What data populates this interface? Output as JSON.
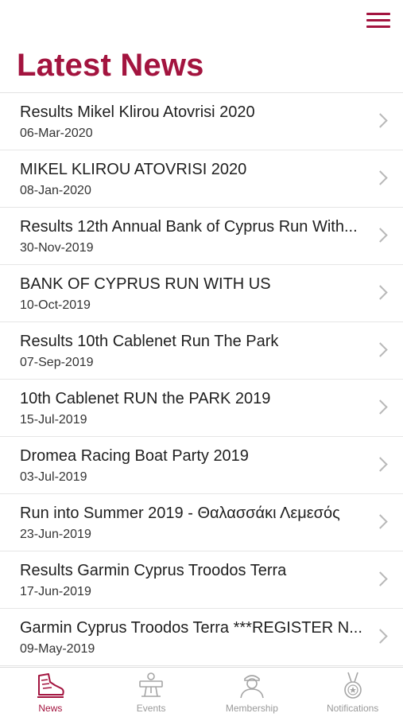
{
  "header": {
    "title": "Latest News",
    "menu_icon": "hamburger-menu-icon"
  },
  "colors": {
    "accent": "#a3143f",
    "text": "#1f1f1f",
    "muted": "#9a9a9a",
    "divider": "#e6e6e6"
  },
  "news": [
    {
      "title": "Results Mikel Klirou Atovrisi 2020",
      "date": "06-Mar-2020"
    },
    {
      "title": "MIKEL KLIROU ATOVRISI 2020",
      "date": "08-Jan-2020"
    },
    {
      "title": "Results 12th Annual Bank of Cyprus Run With...",
      "date": "30-Nov-2019"
    },
    {
      "title": "BANK OF CYPRUS RUN WITH US",
      "date": "10-Oct-2019"
    },
    {
      "title": "Results 10th Cablenet Run The Park",
      "date": "07-Sep-2019"
    },
    {
      "title": "10th Cablenet RUN the PARK 2019",
      "date": "15-Jul-2019"
    },
    {
      "title": "Dromea Racing Boat Party 2019",
      "date": "03-Jul-2019"
    },
    {
      "title": "Run into Summer 2019 - Θαλασσάκι Λεμεσός",
      "date": "23-Jun-2019"
    },
    {
      "title": "Results Garmin Cyprus Troodos Terra",
      "date": "17-Jun-2019"
    },
    {
      "title": "Garmin Cyprus Troodos Terra ***REGISTER N...",
      "date": "09-May-2019"
    }
  ],
  "tabs": [
    {
      "label": "News",
      "icon": "running-shoe-icon",
      "active": true
    },
    {
      "label": "Events",
      "icon": "runner-finish-icon",
      "active": false
    },
    {
      "label": "Membership",
      "icon": "member-person-icon",
      "active": false
    },
    {
      "label": "Notifications",
      "icon": "medal-icon",
      "active": false
    }
  ]
}
